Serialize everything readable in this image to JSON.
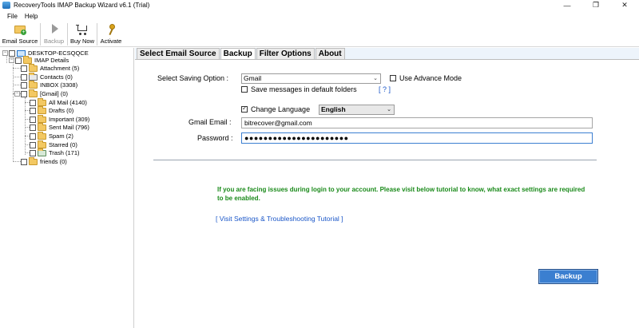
{
  "window": {
    "title": "RecoveryTools IMAP Backup Wizard v6.1 (Trial)",
    "minimize": "—",
    "maximize": "❐",
    "close": "✕"
  },
  "menu": [
    "File",
    "Help"
  ],
  "toolbar": {
    "email_source": "Email Source",
    "backup": "Backup",
    "buy_now": "Buy Now",
    "activate": "Activate"
  },
  "tree": {
    "root": "DESKTOP-ECSQQCE",
    "imap": "IMAP Details",
    "items": [
      "Attachment (5)",
      "Contacts (0)",
      "INBOX (3308)",
      "[Gmail] (0)",
      "All Mail (4140)",
      "Drafts (0)",
      "Important (309)",
      "Sent Mail (796)",
      "Spam (2)",
      "Starred (0)",
      "Trash (171)",
      "friends (0)"
    ]
  },
  "tabs": [
    "Select Email Source",
    "Backup",
    "Filter Options",
    "About"
  ],
  "form": {
    "saving_option_label": "Select Saving Option :",
    "saving_option_value": "Gmail",
    "advance_mode": "Use Advance Mode",
    "save_default": "Save messages in default folders",
    "help": "[ ? ]",
    "change_language": "Change Language",
    "language_value": "English",
    "email_label": "Gmail Email :",
    "email_value": "bitrecover@gmail.com",
    "password_label": "Password :",
    "password_value": "●●●●●●●●●●●●●●●●●●●●●●"
  },
  "notice": "If you are facing issues during login to your account. Please visit below tutorial to know, what exact settings are required to be enabled.",
  "tutorial_link": "[ Visit Settings & Troubleshooting Tutorial ]",
  "backup_button": "Backup",
  "colors": {
    "accent": "#3b7fd0",
    "notice": "#1a8a1a",
    "link": "#1a56c8"
  }
}
